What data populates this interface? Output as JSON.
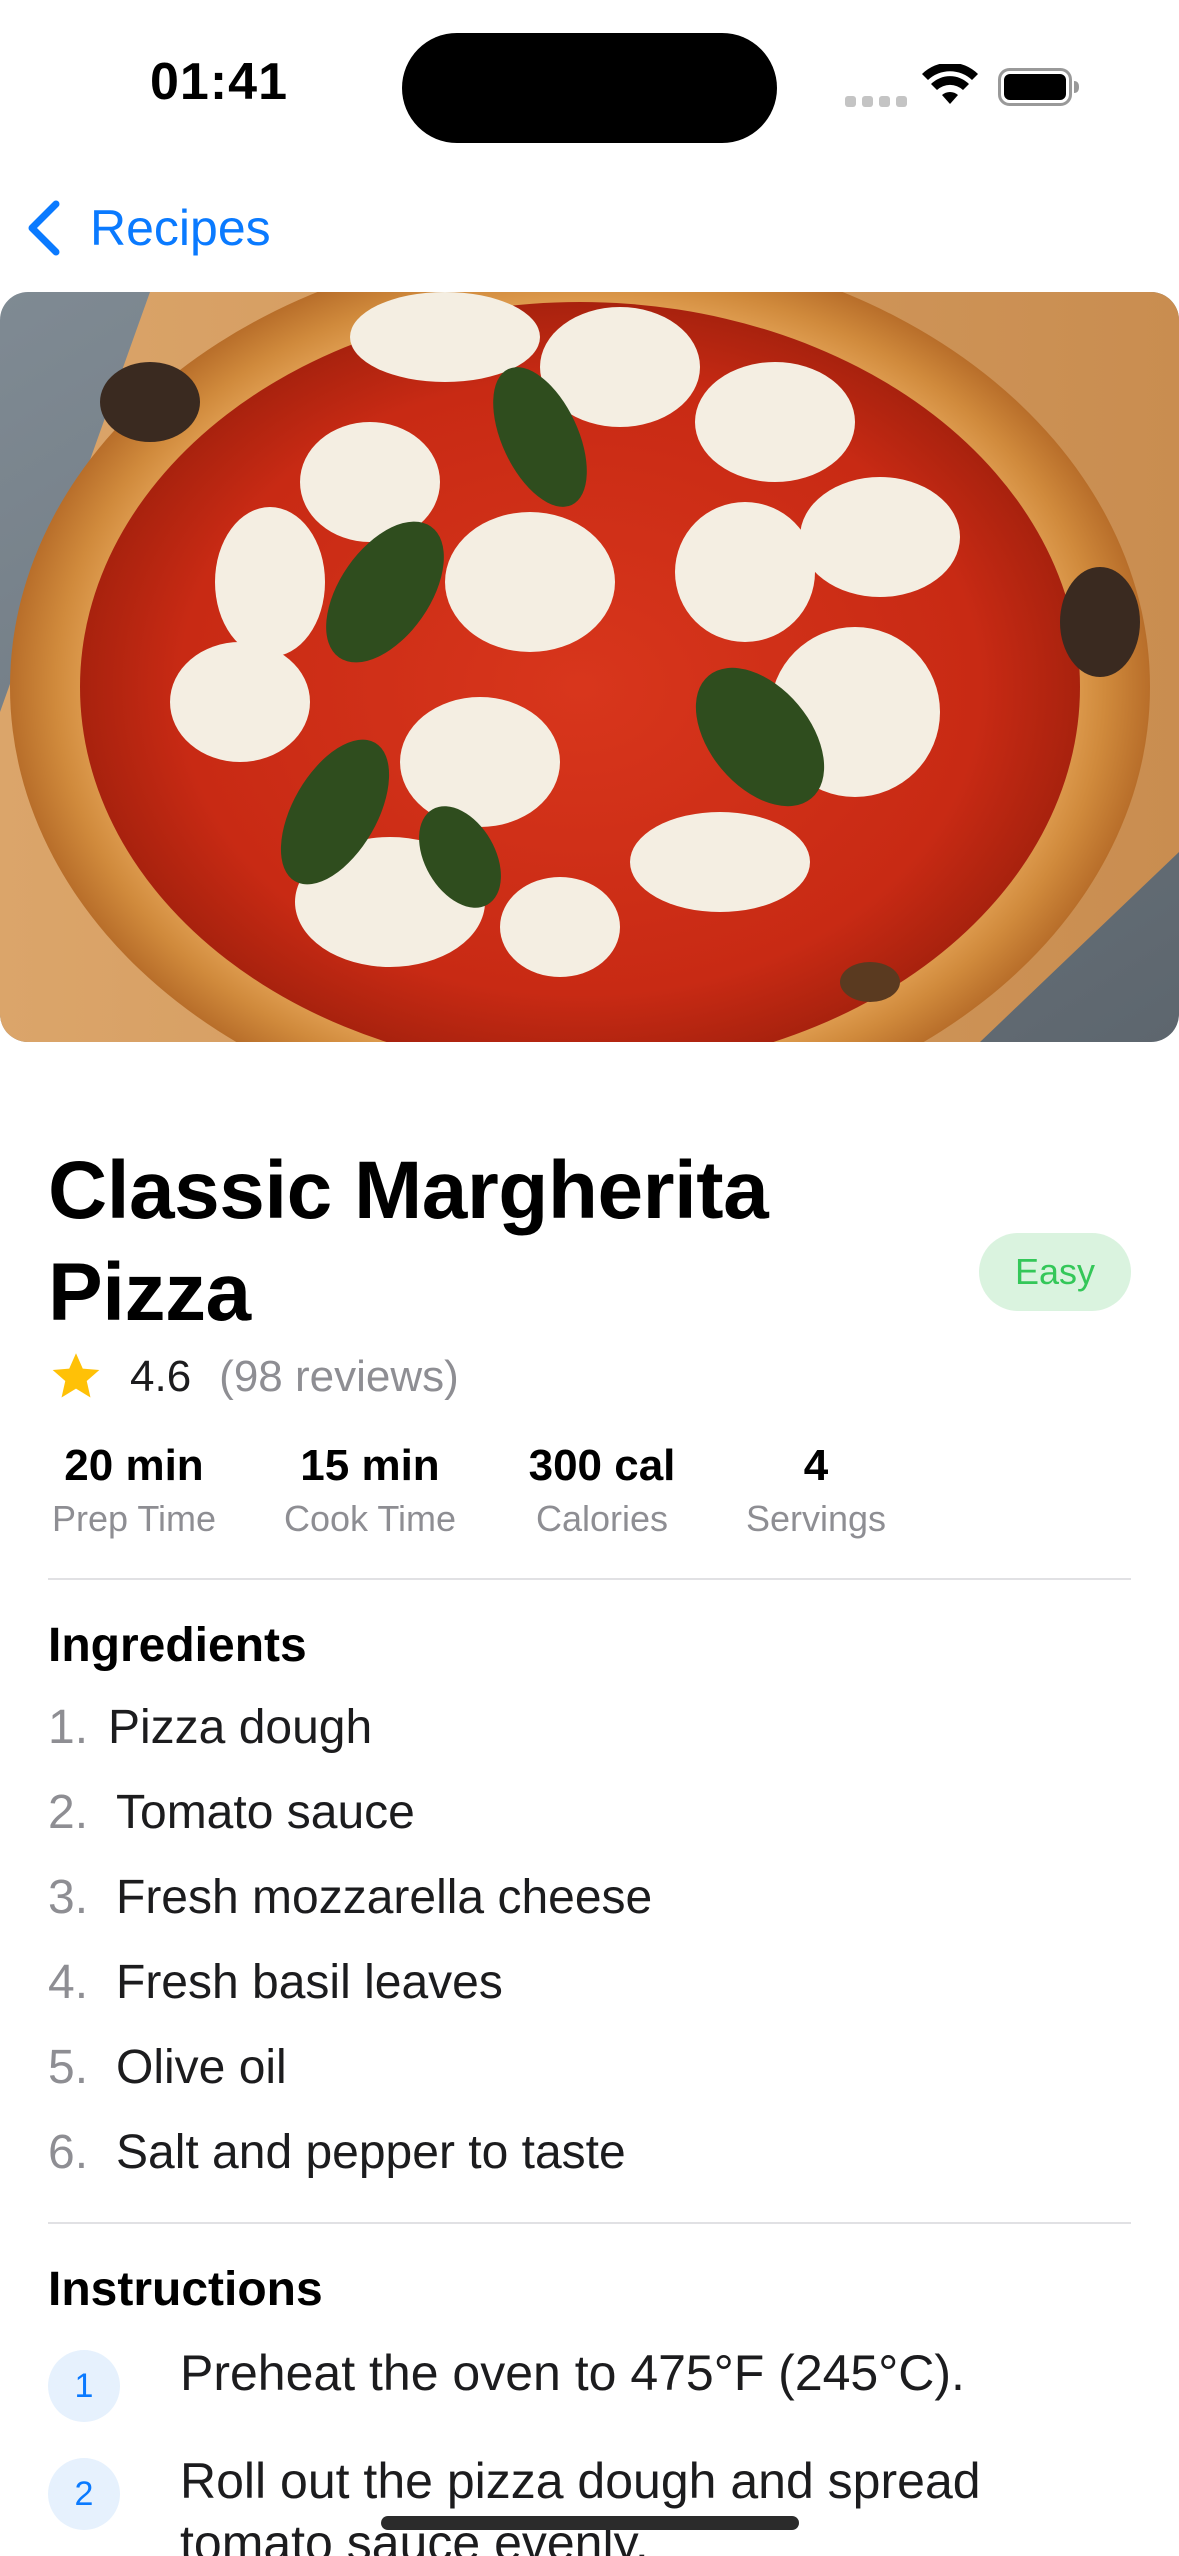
{
  "status_bar": {
    "time": "01:41"
  },
  "nav": {
    "back_label": "Recipes",
    "back_icon": "chevron-left-icon"
  },
  "recipe": {
    "title": "Classic Margherita Pizza",
    "difficulty": "Easy",
    "rating": "4.6",
    "reviews": "(98 reviews)",
    "stats": [
      {
        "value": "20 min",
        "label": "Prep Time"
      },
      {
        "value": "15 min",
        "label": "Cook Time"
      },
      {
        "value": "300 cal",
        "label": "Calories"
      },
      {
        "value": "4",
        "label": "Servings"
      }
    ]
  },
  "ingredients": {
    "title": "Ingredients",
    "items": [
      {
        "num": "1.",
        "text": "Pizza dough"
      },
      {
        "num": "2.",
        "text": "Tomato sauce"
      },
      {
        "num": "3.",
        "text": "Fresh mozzarella cheese"
      },
      {
        "num": "4.",
        "text": "Fresh basil leaves"
      },
      {
        "num": "5.",
        "text": "Olive oil"
      },
      {
        "num": "6.",
        "text": "Salt and pepper to taste"
      }
    ]
  },
  "instructions": {
    "title": "Instructions",
    "steps": [
      {
        "num": "1",
        "text": "Preheat the oven to 475°F (245°C)."
      },
      {
        "num": "2",
        "text": "Roll out the pizza dough and spread tomato sauce evenly."
      }
    ]
  },
  "colors": {
    "accent": "#0a7aff",
    "badge_bg": "#daf3df",
    "badge_text": "#34c759",
    "star": "#ffc107",
    "secondary_text": "#8e8e93"
  }
}
